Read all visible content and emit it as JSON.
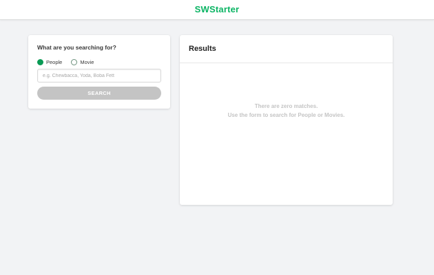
{
  "header": {
    "brand": "SWStarter"
  },
  "search": {
    "title": "What are you searching for?",
    "options": [
      {
        "label": "People",
        "checked": true
      },
      {
        "label": "Movie",
        "checked": false
      }
    ],
    "placeholder": "e.g. Chewbacca, Yoda, Boba Fett",
    "value": "",
    "button_label": "SEARCH"
  },
  "results": {
    "title": "Results",
    "empty_line1": "There are zero matches.",
    "empty_line2": "Use the form to search for People or Movies."
  },
  "colors": {
    "brand": "#0ab463",
    "radio_checked": "#0a9a55",
    "button_disabled": "#c4c4c4",
    "page_bg": "#f2f3f5"
  }
}
